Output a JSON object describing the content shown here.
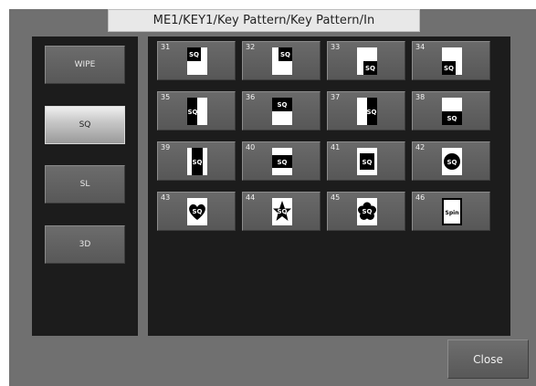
{
  "title": "ME1/KEY1/Key Pattern/Key Pattern/In",
  "categories": [
    {
      "label": "WIPE",
      "active": false
    },
    {
      "label": "SQ",
      "active": true
    },
    {
      "label": "SL",
      "active": false
    },
    {
      "label": "3D",
      "active": false
    }
  ],
  "patterns": [
    {
      "number": "31",
      "icon": "sq-top-left-icon",
      "text": "SQ"
    },
    {
      "number": "32",
      "icon": "sq-top-right-icon",
      "text": "SQ"
    },
    {
      "number": "33",
      "icon": "sq-bottom-right-icon",
      "text": "SQ"
    },
    {
      "number": "34",
      "icon": "sq-bottom-left-icon",
      "text": "SQ"
    },
    {
      "number": "35",
      "icon": "sq-left-half-icon",
      "text": "SQ"
    },
    {
      "number": "36",
      "icon": "sq-top-half-icon",
      "text": "SQ"
    },
    {
      "number": "37",
      "icon": "sq-right-half-icon",
      "text": "SQ"
    },
    {
      "number": "38",
      "icon": "sq-bottom-half-icon",
      "text": "SQ"
    },
    {
      "number": "39",
      "icon": "sq-vertical-center-icon",
      "text": "SQ"
    },
    {
      "number": "40",
      "icon": "sq-horizontal-center-icon",
      "text": "SQ"
    },
    {
      "number": "41",
      "icon": "sq-box-icon",
      "text": "SQ"
    },
    {
      "number": "42",
      "icon": "sq-circle-icon",
      "text": "SQ"
    },
    {
      "number": "43",
      "icon": "sq-heart-icon",
      "text": "SQ"
    },
    {
      "number": "44",
      "icon": "sq-star-icon",
      "text": "SQ"
    },
    {
      "number": "45",
      "icon": "sq-flower-icon",
      "text": "SQ"
    },
    {
      "number": "46",
      "icon": "spin-icon",
      "text": "Spin"
    }
  ],
  "close_label": "Close"
}
